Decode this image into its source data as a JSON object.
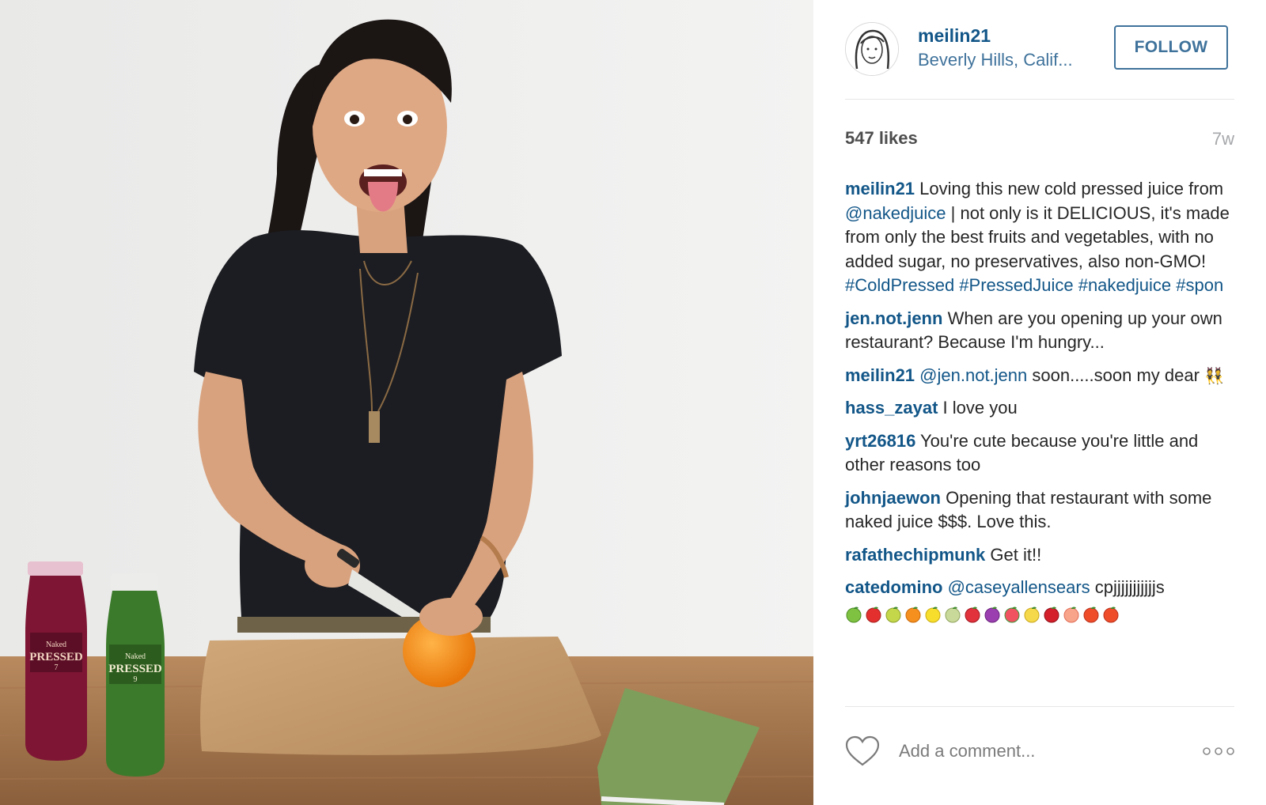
{
  "post": {
    "author": "meilin21",
    "location": "Beverly Hills, Calif...",
    "follow_label": "FOLLOW",
    "likes": "547 likes",
    "age": "7w",
    "bottle_brand": "Naked",
    "bottle_name": "PRESSED",
    "bottle_1_number": "7",
    "bottle_2_number": "9"
  },
  "comments": [
    {
      "user": "meilin21",
      "text_1": " Loving this new cold pressed juice from ",
      "mention": "@nakedjuice",
      "text_2": " | not only is it DELICIOUS, it's made from only the best fruits and vegetables, with no added sugar, no preservatives, also non-GMO! ",
      "hashtags": "#ColdPressed #PressedJuice #nakedjuice #spon"
    },
    {
      "user": "jen.not.jenn",
      "text": " When are you opening up your own restaurant? Because I'm hungry..."
    },
    {
      "user": "meilin21",
      "mention": "@jen.not.jenn",
      "text": " soon.....soon my dear ",
      "emoji": "👯"
    },
    {
      "user": "hass_zayat",
      "text": " I love you"
    },
    {
      "user": "yrt26816",
      "text": " You're cute because you're little and other reasons too"
    },
    {
      "user": "johnjaewon",
      "text": " Opening that restaurant with some naked juice $$$. Love this."
    },
    {
      "user": "rafathechipmunk",
      "text": " Get it!!"
    },
    {
      "user": "catedomino",
      "mention": "@caseyallensears",
      "text": " cpjjjjjjjjjjjs"
    }
  ],
  "fruit_emojis": [
    "green-apple",
    "red-apple",
    "pear",
    "tangerine",
    "lemon",
    "melon",
    "strawberry",
    "grapes",
    "watermelon",
    "banana",
    "cherries",
    "peach",
    "tomato",
    "tomato"
  ],
  "footer": {
    "comment_placeholder": "Add a comment..."
  },
  "icons": {
    "like": "heart-outline-icon",
    "more": "ellipsis-icon"
  },
  "colors": {
    "username": "#125688",
    "follow": "#3f729b",
    "muted": "#a5a7aa"
  }
}
